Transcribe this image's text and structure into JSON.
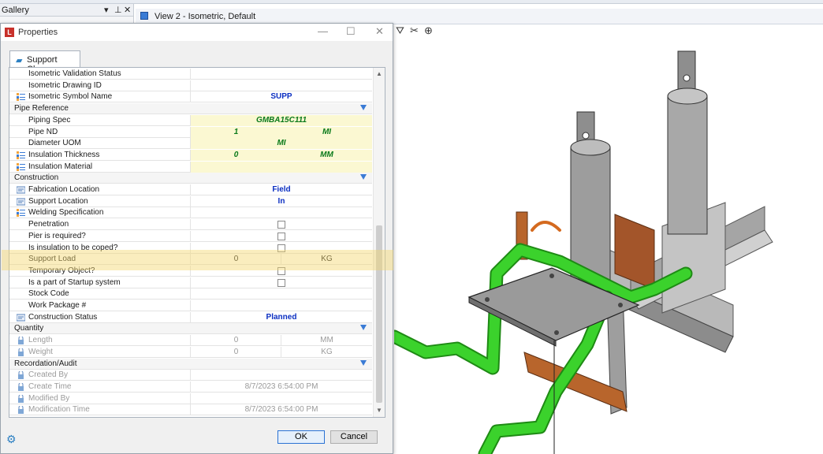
{
  "gallery": {
    "title": "Gallery",
    "controls": [
      "▾",
      "⊥",
      "✕"
    ]
  },
  "view": {
    "tab_title": "View 2 - Isometric, Default"
  },
  "dialog": {
    "title": "Properties",
    "tab": "Support Clamp",
    "ok_label": "OK",
    "cancel_label": "Cancel",
    "rows": [
      {
        "type": "prop",
        "label": "Isometric Validation Status",
        "v": ""
      },
      {
        "type": "prop",
        "label": "Isometric Drawing ID",
        "v": ""
      },
      {
        "type": "prop",
        "label": "Isometric Symbol Name",
        "v": "SUPP",
        "style": "blue",
        "icon": "list"
      },
      {
        "type": "cat",
        "label": "Pipe Reference"
      },
      {
        "type": "prop",
        "label": "Piping Spec",
        "v": "GMBA15C111",
        "style": "green",
        "yellow": true
      },
      {
        "type": "prop",
        "label": "Pipe ND",
        "v1": "1",
        "v2": "MI",
        "style": "green",
        "yellow": true
      },
      {
        "type": "prop",
        "label": "Diameter UOM",
        "v": "MI",
        "style": "green",
        "yellow": true
      },
      {
        "type": "prop",
        "label": "Insulation Thickness",
        "v1": "0",
        "v2": "MM",
        "style": "green",
        "yellow": true,
        "icon": "list"
      },
      {
        "type": "prop",
        "label": "Insulation Material",
        "v": "",
        "yellow": true,
        "icon": "list"
      },
      {
        "type": "cat",
        "label": "Construction"
      },
      {
        "type": "prop",
        "label": "Fabrication Location",
        "v": "Field",
        "style": "blue",
        "icon": "edit"
      },
      {
        "type": "prop",
        "label": "Support Location",
        "v": "In",
        "style": "blue",
        "icon": "edit"
      },
      {
        "type": "prop",
        "label": "Welding Specification",
        "v": "",
        "icon": "list"
      },
      {
        "type": "prop",
        "label": "Penetration",
        "check": true
      },
      {
        "type": "prop",
        "label": "Pier is required?",
        "check": true
      },
      {
        "type": "prop",
        "label": "Is insulation to be coped?",
        "check": true
      },
      {
        "type": "prop",
        "label": "Support Load",
        "v1": "0",
        "v2": "KG"
      },
      {
        "type": "prop",
        "label": "Temporary Object?",
        "check": true
      },
      {
        "type": "prop",
        "label": "Is a part of Startup system",
        "check": true
      },
      {
        "type": "prop",
        "label": "Stock Code",
        "v": ""
      },
      {
        "type": "prop",
        "label": "Work Package #",
        "v": ""
      },
      {
        "type": "prop",
        "label": "Construction Status",
        "v": "Planned",
        "style": "blue",
        "icon": "edit"
      },
      {
        "type": "cat",
        "label": "Quantity"
      },
      {
        "type": "prop",
        "label": "Length",
        "v1": "0",
        "v2": "MM",
        "gray": true,
        "icon": "lock"
      },
      {
        "type": "prop",
        "label": "Weight",
        "v1": "0",
        "v2": "KG",
        "gray": true,
        "icon": "lock"
      },
      {
        "type": "cat",
        "label": "Recordation/Audit"
      },
      {
        "type": "prop",
        "label": "Created By",
        "v": "",
        "gray": true,
        "icon": "lock"
      },
      {
        "type": "prop",
        "label": "Create Time",
        "v": "8/7/2023 6:54:00 PM",
        "gray": true,
        "icon": "lock"
      },
      {
        "type": "prop",
        "label": "Modified By",
        "v": "",
        "gray": true,
        "icon": "lock"
      },
      {
        "type": "prop",
        "label": "Modification Time",
        "v": "8/7/2023 6:54:00 PM",
        "gray": true,
        "icon": "lock"
      }
    ]
  },
  "colors": {
    "accent": "#3a7bd5",
    "value_blue": "#0b2fc2",
    "value_green": "#0a7a1a",
    "highlight": "#f5d76e",
    "pipe_green": "#3bd22c",
    "bracket_copper": "#b8652c"
  }
}
